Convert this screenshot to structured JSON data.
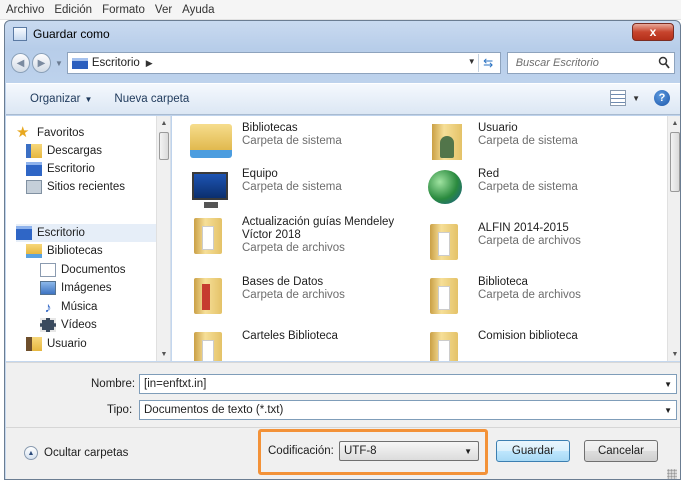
{
  "app_menu": [
    "Archivo",
    "Edición",
    "Formato",
    "Ver",
    "Ayuda"
  ],
  "dialog": {
    "title": "Guardar como",
    "close_label": "x"
  },
  "address": {
    "location": "Escritorio",
    "separator": "▶",
    "search_placeholder": "Buscar Escritorio"
  },
  "toolbar": {
    "organize_label": "Organizar",
    "new_folder_label": "Nueva carpeta",
    "help_label": "?"
  },
  "sidebar": {
    "favorites": "Favoritos",
    "downloads": "Descargas",
    "desktop_fav": "Escritorio",
    "recent": "Sitios recientes",
    "desktop": "Escritorio",
    "libraries": "Bibliotecas",
    "documents": "Documentos",
    "pictures": "Imágenes",
    "music": "Música",
    "videos": "Vídeos",
    "user": "Usuario"
  },
  "files": [
    {
      "name": "Bibliotecas",
      "type": "Carpeta de sistema"
    },
    {
      "name": "Usuario",
      "type": "Carpeta de sistema"
    },
    {
      "name": "Equipo",
      "type": "Carpeta de sistema"
    },
    {
      "name": "Red",
      "type": "Carpeta de sistema"
    },
    {
      "name": "Actualización guías Mendeley",
      "name2": "Víctor 2018",
      "type": "Carpeta de archivos"
    },
    {
      "name": "ALFIN 2014-2015",
      "type": "Carpeta de archivos"
    },
    {
      "name": "Bases de Datos",
      "type": "Carpeta de archivos"
    },
    {
      "name": "Biblioteca",
      "type": "Carpeta de archivos"
    },
    {
      "name": "Carteles Biblioteca",
      "type": ""
    },
    {
      "name": "Comision biblioteca",
      "type": ""
    }
  ],
  "form": {
    "name_label": "Nombre:",
    "name_value": "[in=enftxt.in]",
    "type_label": "Tipo:",
    "type_value": "Documentos de texto (*.txt)",
    "hide_folders": "Ocultar carpetas",
    "encoding_label": "Codificación:",
    "encoding_value": "UTF-8",
    "save": "Guardar",
    "cancel": "Cancelar"
  },
  "colors": {
    "highlight": "#f39238",
    "title_gradient": "#c9daf0",
    "close_button": "#c7442d"
  }
}
